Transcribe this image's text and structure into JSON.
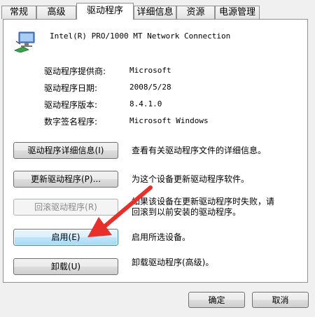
{
  "tabs": [
    {
      "label": "常规"
    },
    {
      "label": "高级"
    },
    {
      "label": "驱动程序",
      "active": true
    },
    {
      "label": "详细信息"
    },
    {
      "label": "资源"
    },
    {
      "label": "电源管理"
    }
  ],
  "device": {
    "name": "Intel(R) PRO/1000 MT Network Connection",
    "icon": "network-adapter-icon"
  },
  "info": {
    "provider_label": "驱动程序提供商:",
    "provider_value": "Microsoft",
    "date_label": "驱动程序日期:",
    "date_value": "2008/5/28",
    "version_label": "驱动程序版本:",
    "version_value": "8.4.1.0",
    "signer_label": "数字签名程序:",
    "signer_value": "Microsoft Windows"
  },
  "actions": {
    "details_button": "驱动程序详细信息(I)",
    "details_desc": "查看有关驱动程序文件的详细信息。",
    "update_button": "更新驱动程序(P)...",
    "update_desc": "为这个设备更新驱动程序软件。",
    "rollback_button": "回滚驱动程序(R)",
    "rollback_desc_line1": "如果该设备在更新驱动程序时失败，请",
    "rollback_desc_line2": "回滚到以前安装的驱动程序。",
    "enable_button": "启用(E)",
    "enable_desc": "启用所选设备。",
    "uninstall_button": "卸载(U)",
    "uninstall_desc": "卸载驱动程序(高级)。"
  },
  "dialog": {
    "ok_button": "确定",
    "cancel_button": "取消"
  },
  "colors": {
    "annotation_arrow": "#e8302a",
    "focus_border": "#3c7fb1"
  }
}
